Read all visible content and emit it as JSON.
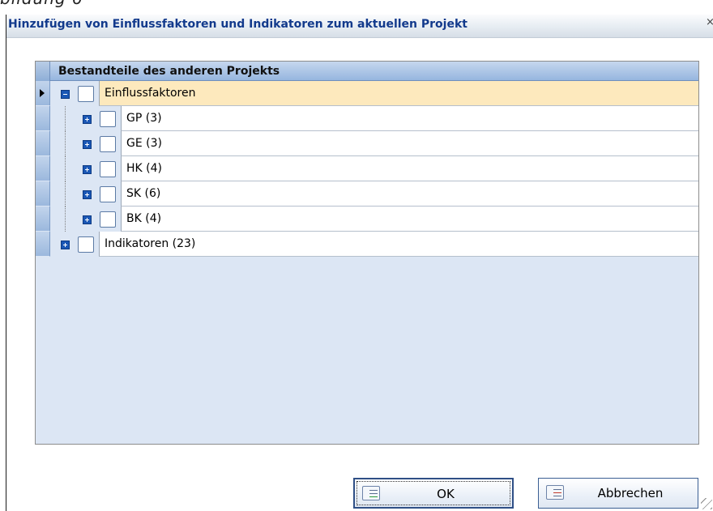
{
  "caption": "bildung 6",
  "window": {
    "title": "Hinzufügen von Einflussfaktoren und Indikatoren zum aktuellen Projekt",
    "close_glyph": "×"
  },
  "tree": {
    "column_header": "Bestandteile des anderen Projekts",
    "rows": [
      {
        "label": "Einflussfaktoren",
        "level": 0,
        "expanded": true,
        "current": true
      },
      {
        "label": "GP (3)",
        "level": 1,
        "expanded": false
      },
      {
        "label": "GE (3)",
        "level": 1,
        "expanded": false
      },
      {
        "label": "HK (4)",
        "level": 1,
        "expanded": false
      },
      {
        "label": "SK (6)",
        "level": 1,
        "expanded": false
      },
      {
        "label": "BK (4)",
        "level": 1,
        "expanded": false
      },
      {
        "label": "Indikatoren (23)",
        "level": 0,
        "expanded": false
      }
    ]
  },
  "buttons": {
    "ok": {
      "label": "OK",
      "icon": "checklist-icon"
    },
    "cancel": {
      "label": "Abbrechen",
      "icon": "cancel-list-icon"
    }
  },
  "colors": {
    "header": "#96b6df",
    "selected_row": "#fde9bd",
    "tree_background": "#dce6f4",
    "title_text": "#123a8c"
  }
}
